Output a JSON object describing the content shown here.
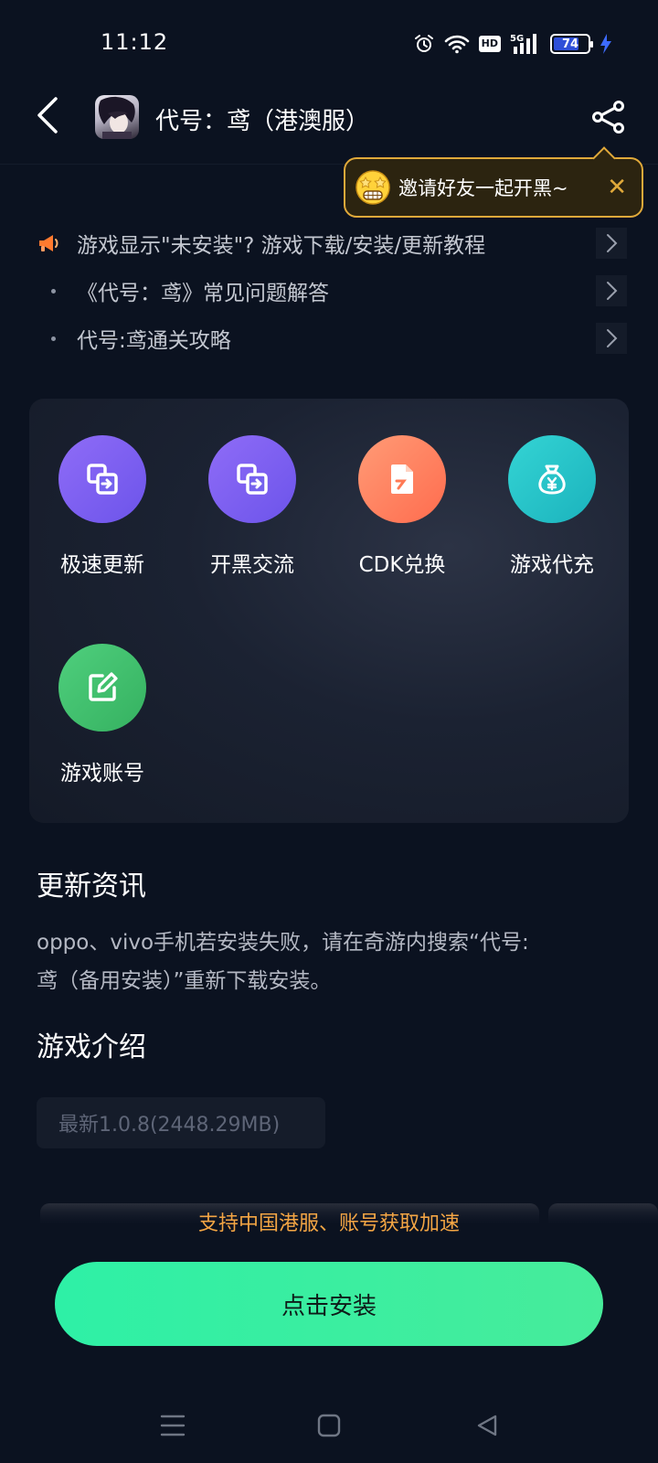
{
  "status_bar": {
    "time": "11:12",
    "network_badge": "HD",
    "signal_label": "5G",
    "battery_level": "74",
    "icons": [
      "alarm-icon",
      "wifi-icon",
      "signal-icon",
      "battery-icon",
      "charging-icon"
    ]
  },
  "header": {
    "title": "代号：鸢（港澳服）",
    "back_icon": "chevron-left-icon",
    "share_icon": "share-icon"
  },
  "invite_tooltip": {
    "text": "邀请好友一起开黑~",
    "close_label": "✕"
  },
  "notices": [
    {
      "text": "游戏显示\"未安装\"? 游戏下载/安装/更新教程",
      "lead": "megaphone-icon"
    },
    {
      "text": "《代号：鸢》常见问题解答",
      "lead": "bullet"
    },
    {
      "text": "代号:鸢通关攻略",
      "lead": "bullet"
    }
  ],
  "tools": [
    {
      "label": "极速更新",
      "icon": "swap-icon",
      "color": "#7b5ff0"
    },
    {
      "label": "开黑交流",
      "icon": "swap-icon",
      "color": "#7b5ff0"
    },
    {
      "label": "CDK兑换",
      "icon": "document-icon",
      "color": "#ff7a55"
    },
    {
      "label": "游戏代充",
      "icon": "money-bag-icon",
      "color": "#22bfc6"
    },
    {
      "label": "游戏账号",
      "icon": "edit-icon",
      "color": "#3dbb6b"
    }
  ],
  "update_news": {
    "title": "更新资讯",
    "line1": "oppo、vivo手机若安装失败，请在奇游内搜索“代号:",
    "line2": "鸢（备用安装）”重新下载安装。"
  },
  "game_intro": {
    "title": "游戏介绍",
    "version": "最新1.0.8(2448.29MB)"
  },
  "support_text": "支持中国港服、账号获取加速",
  "install_button": "点击安装",
  "colors": {
    "background": "#0b1220",
    "accent_green": "#2ef0a6",
    "accent_orange": "#f3a544",
    "tooltip_border": "#e0a93a"
  },
  "nav": [
    "menu-icon",
    "home-icon",
    "back-triangle-icon"
  ]
}
